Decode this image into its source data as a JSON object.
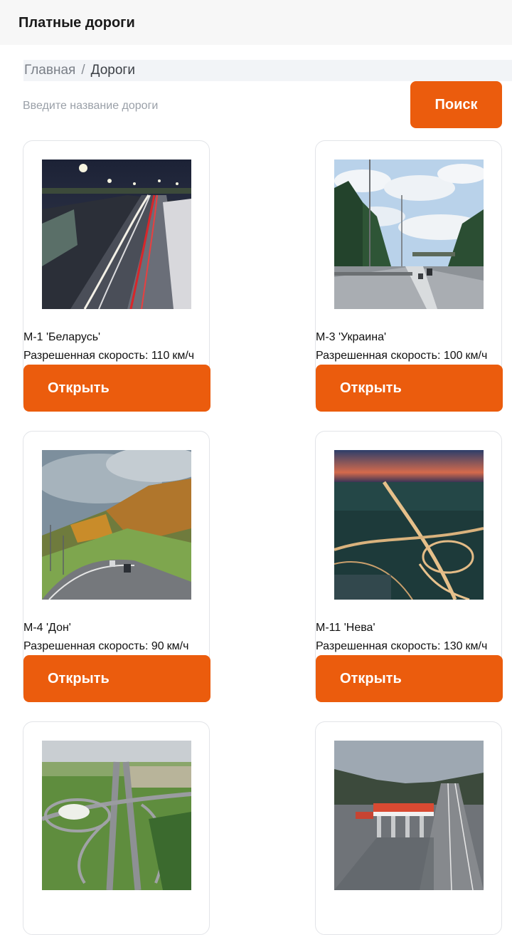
{
  "header": {
    "title": "Платные дороги"
  },
  "breadcrumb": {
    "home": "Главная",
    "separator": "/",
    "current": "Дороги"
  },
  "search": {
    "placeholder": "Введите название дороги",
    "value": "",
    "button_label": "Поиск"
  },
  "colors": {
    "accent": "#eb5c0d",
    "header_bg": "#f7f7f7",
    "breadcrumb_bg": "#f2f4f7"
  },
  "roads": [
    {
      "name": "М-1 'Беларусь'",
      "speed_label": "Разрешенная скорость:",
      "speed_value": "110",
      "speed_unit": "км/ч",
      "button_label": "Открыть",
      "photo": "night-highway-light-trails"
    },
    {
      "name": "М-3 'Украина'",
      "speed_label": "Разрешенная скорость:",
      "speed_value": "100",
      "speed_unit": "км/ч",
      "button_label": "Открыть",
      "photo": "daytime-highway-forest-clouds"
    },
    {
      "name": "М-4 'Дон'",
      "speed_label": "Разрешенная скорость:",
      "speed_value": "90",
      "speed_unit": "км/ч",
      "button_label": "Открыть",
      "photo": "curved-highway-autumn-hill"
    },
    {
      "name": "М-11 'Нева'",
      "speed_label": "Разрешенная скорость:",
      "speed_value": "130",
      "speed_unit": "км/ч",
      "button_label": "Открыть",
      "photo": "aerial-interchange-dusk"
    },
    {
      "name": "",
      "speed_label": "",
      "speed_value": "",
      "speed_unit": "",
      "button_label": "",
      "photo": "aerial-cloverleaf-interchange"
    },
    {
      "name": "",
      "speed_label": "",
      "speed_value": "",
      "speed_unit": "",
      "button_label": "",
      "photo": "toll-plaza-highway"
    }
  ]
}
